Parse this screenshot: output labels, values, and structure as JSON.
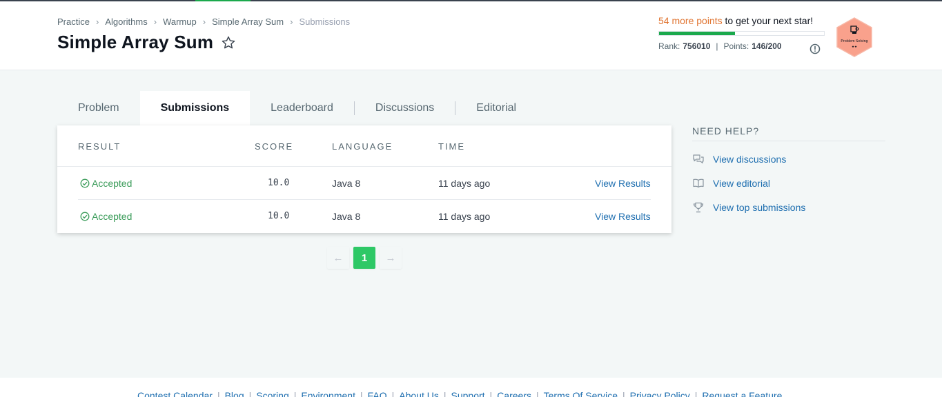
{
  "breadcrumb": {
    "items": [
      "Practice",
      "Algorithms",
      "Warmup",
      "Simple Array Sum"
    ],
    "current": "Submissions"
  },
  "page_title": "Simple Array Sum",
  "progress": {
    "points_label": "54 more points",
    "rest_label": "to get your next star!",
    "fill_fraction": 0.46,
    "rank_label": "Rank:",
    "rank_value": "756010",
    "points_key": "Points:",
    "points_value": "146/200",
    "separator": "|"
  },
  "badge": {
    "label": "Problem Solving",
    "stars": "★★",
    "color": "#f9a18c"
  },
  "tabs": [
    {
      "label": "Problem",
      "active": false
    },
    {
      "label": "Submissions",
      "active": true
    },
    {
      "label": "Leaderboard",
      "active": false
    },
    {
      "label": "Discussions",
      "active": false
    },
    {
      "label": "Editorial",
      "active": false
    }
  ],
  "table": {
    "headers": {
      "result": "RESULT",
      "score": "SCORE",
      "language": "LANGUAGE",
      "time": "TIME"
    },
    "rows": [
      {
        "status": "Accepted",
        "score": "10.0",
        "language": "Java 8",
        "time": "11 days ago",
        "action": "View Results"
      },
      {
        "status": "Accepted",
        "score": "10.0",
        "language": "Java 8",
        "time": "11 days ago",
        "action": "View Results"
      }
    ]
  },
  "pagination": {
    "prev": "←",
    "current": "1",
    "next": "→"
  },
  "help": {
    "title": "NEED HELP?",
    "items": [
      {
        "label": "View discussions",
        "icon": "chat-bubbles-icon"
      },
      {
        "label": "View editorial",
        "icon": "open-book-icon"
      },
      {
        "label": "View top submissions",
        "icon": "trophy-icon"
      }
    ]
  },
  "footer": {
    "links": [
      "Contest Calendar",
      "Blog",
      "Scoring",
      "Environment",
      "FAQ",
      "About Us",
      "Support",
      "Careers",
      "Terms Of Service",
      "Privacy Policy",
      "Request a Feature"
    ],
    "separator": "|"
  },
  "colors": {
    "accent_green": "#1ba94c",
    "pager_active": "#2ec866",
    "link_blue": "#1f6fb0",
    "points_orange": "#e0732f",
    "accepted_green": "#3b9c5a"
  }
}
